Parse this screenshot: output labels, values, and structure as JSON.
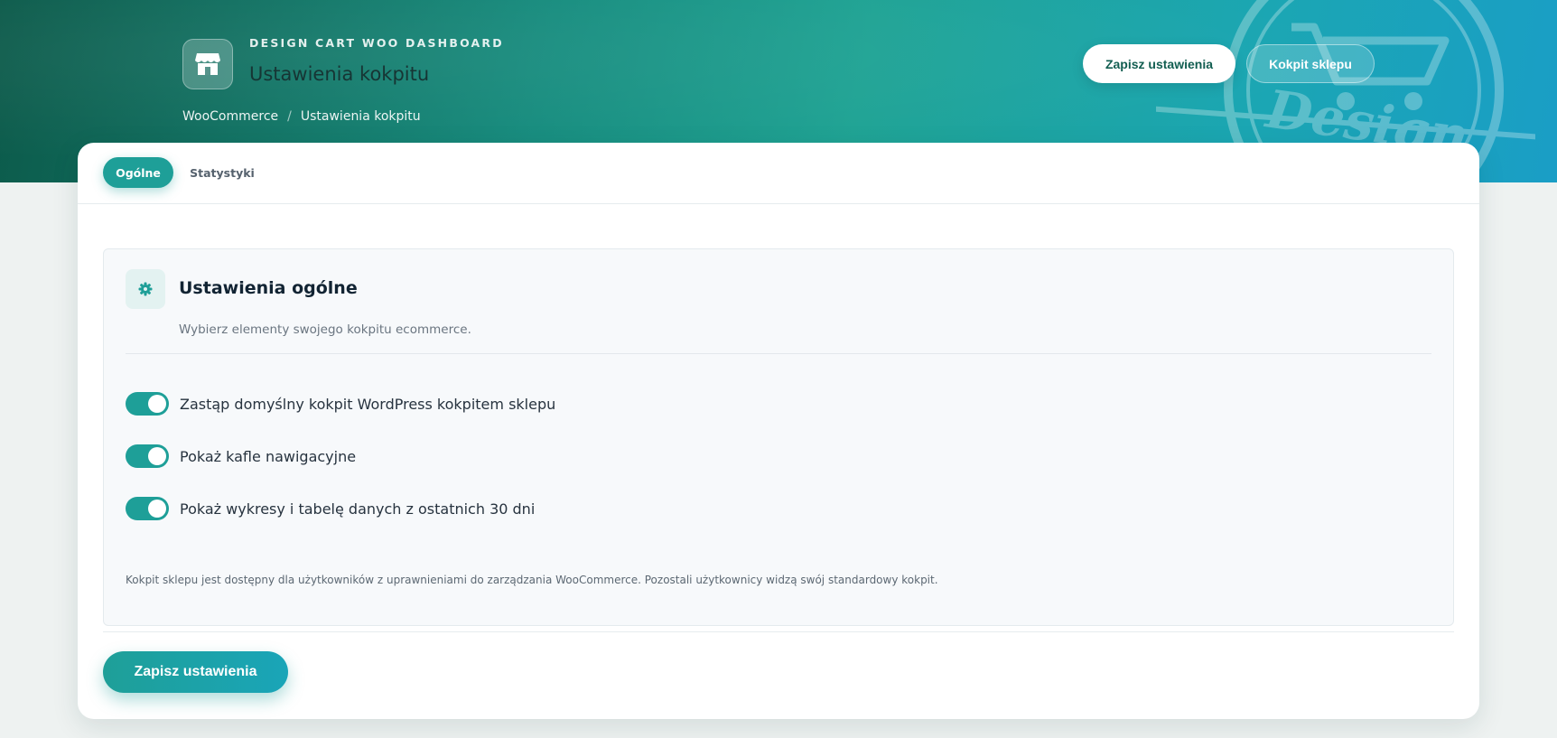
{
  "header": {
    "kicker": "DESIGN CART WOO DASHBOARD",
    "title": "Ustawienia kokpitu",
    "breadcrumb": [
      "WooCommerce",
      "Ustawienia kokpitu"
    ],
    "breadcrumb_sep": "/",
    "save_label": "Zapisz ustawienia",
    "shop_label": "Kokpit sklepu"
  },
  "tabs": [
    {
      "label": "Ogólne",
      "active": true
    },
    {
      "label": "Statystyki",
      "active": false
    }
  ],
  "panel": {
    "title": "Ustawienia ogólne",
    "subtitle": "Wybierz elementy swojego kokpitu ecommerce.",
    "icon": "gear-icon",
    "options": [
      {
        "label": "Zastąp domyślny kokpit WordPress kokpitem sklepu",
        "enabled": true
      },
      {
        "label": "Pokaż kafle nawigacyjne",
        "enabled": true
      },
      {
        "label": "Pokaż wykresy i tabelę danych z ostatnich 30 dni",
        "enabled": true
      }
    ],
    "note": "Kokpit sklepu jest dostępny dla użytkowników z uprawnieniami do zarządzania WooCommerce. Pozostali użytkownicy widzą swój standardowy kokpit."
  },
  "footer": {
    "save_label": "Zapisz ustawienia"
  },
  "colors": {
    "accent": "#1e9f98",
    "header_start": "#0c5a4a",
    "header_end": "#1a9ec6"
  }
}
